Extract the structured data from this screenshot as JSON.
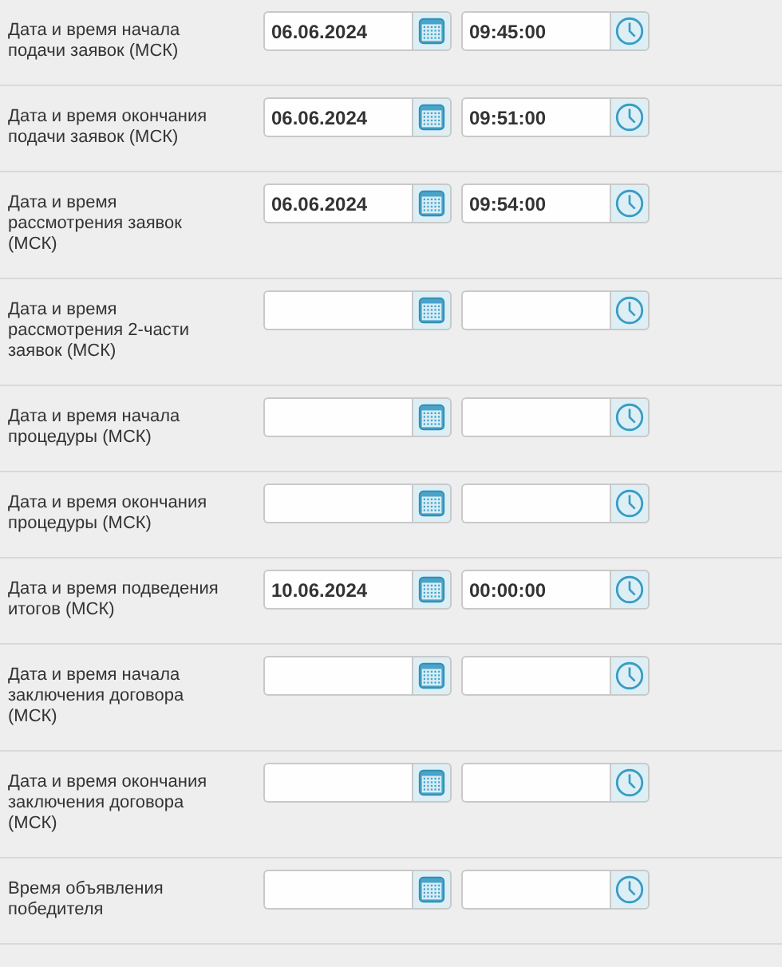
{
  "rows": [
    {
      "label": "Дата и время начала подачи заявок (МСК)",
      "date": "06.06.2024",
      "time": "09:45:00"
    },
    {
      "label": "Дата и время окончания подачи заявок (МСК)",
      "date": "06.06.2024",
      "time": "09:51:00"
    },
    {
      "label": "Дата и время рассмотрения заявок (МСК)",
      "date": "06.06.2024",
      "time": "09:54:00"
    },
    {
      "label": "Дата и время рассмотрения 2-части заявок (МСК)"
    },
    {
      "label": "Дата и время начала процедуры (МСК)"
    },
    {
      "label": "Дата и время окончания процедуры (МСК)"
    },
    {
      "label": "Дата и время подведения итогов (МСК)",
      "date": "10.06.2024",
      "time": "00:00:00"
    },
    {
      "label": "Дата и время начала заключения договора (МСК)"
    },
    {
      "label": "Дата и время окончания заключения договора (МСК)"
    },
    {
      "label": "Время объявления победителя"
    }
  ]
}
